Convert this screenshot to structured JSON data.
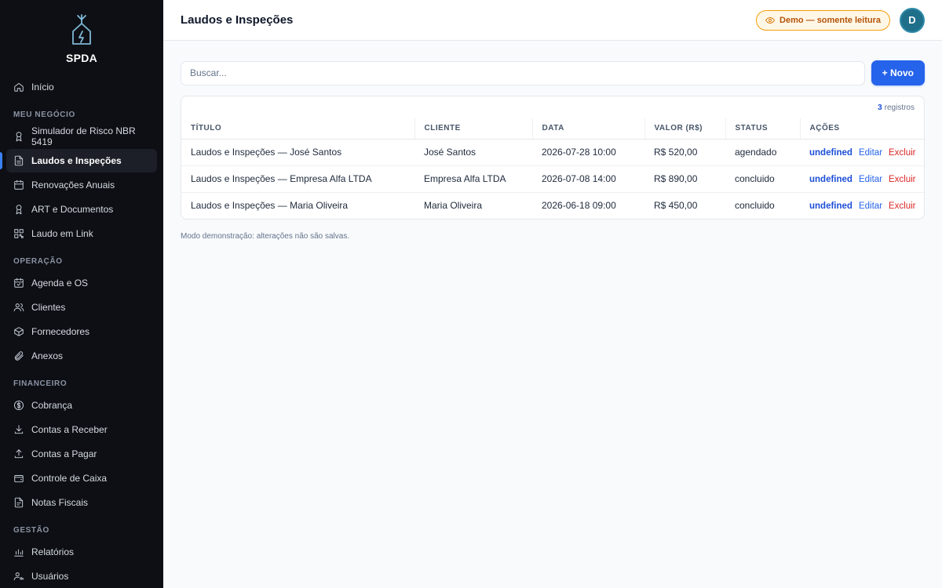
{
  "brand": {
    "name": "SPDA"
  },
  "sidebar": {
    "top": [
      {
        "label": "Início",
        "icon": "home-icon"
      }
    ],
    "sections": [
      {
        "title": "MEU NEGÓCIO",
        "items": [
          {
            "label": "Simulador de Risco NBR 5419",
            "icon": "award-icon"
          },
          {
            "label": "Laudos e Inspeções",
            "icon": "file-text-icon",
            "active": true
          },
          {
            "label": "Renovações Anuais",
            "icon": "calendar-icon"
          },
          {
            "label": "ART e Documentos",
            "icon": "award-icon"
          },
          {
            "label": "Laudo em Link",
            "icon": "qr-code-icon"
          }
        ]
      },
      {
        "title": "OPERAÇÃO",
        "items": [
          {
            "label": "Agenda e OS",
            "icon": "calendar-check-icon"
          },
          {
            "label": "Clientes",
            "icon": "users-icon"
          },
          {
            "label": "Fornecedores",
            "icon": "package-icon"
          },
          {
            "label": "Anexos",
            "icon": "paperclip-icon"
          }
        ]
      },
      {
        "title": "FINANCEIRO",
        "items": [
          {
            "label": "Cobrança",
            "icon": "dollar-circle-icon"
          },
          {
            "label": "Contas a Receber",
            "icon": "download-icon"
          },
          {
            "label": "Contas a Pagar",
            "icon": "upload-icon"
          },
          {
            "label": "Controle de Caixa",
            "icon": "wallet-icon"
          },
          {
            "label": "Notas Fiscais",
            "icon": "file-icon"
          }
        ]
      },
      {
        "title": "GESTÃO",
        "items": [
          {
            "label": "Relatórios",
            "icon": "bar-chart-icon"
          },
          {
            "label": "Usuários",
            "icon": "user-key-icon"
          }
        ]
      }
    ]
  },
  "header": {
    "title": "Laudos e Inspeções",
    "demo_badge": "Demo — somente leitura",
    "avatar_initial": "D"
  },
  "search": {
    "placeholder": "Buscar...",
    "value": ""
  },
  "new_button": "+ Novo",
  "records": {
    "count": "3",
    "label": "registros"
  },
  "table": {
    "columns": [
      "TÍTULO",
      "CLIENTE",
      "DATA",
      "VALOR (R$)",
      "STATUS",
      "AÇÕES"
    ],
    "rows": [
      {
        "titulo": "Laudos e Inspeções — José Santos",
        "cliente": "José Santos",
        "data": "2026-07-28 10:00",
        "valor": "R$ 520,00",
        "status": "agendado"
      },
      {
        "titulo": "Laudos e Inspeções — Empresa Alfa LTDA",
        "cliente": "Empresa Alfa LTDA",
        "data": "2026-07-08 14:00",
        "valor": "R$ 890,00",
        "status": "concluido"
      },
      {
        "titulo": "Laudos e Inspeções — Maria Oliveira",
        "cliente": "Maria Oliveira",
        "data": "2026-06-18 09:00",
        "valor": "R$ 450,00",
        "status": "concluido"
      }
    ],
    "actions": {
      "view": "undefined",
      "edit": "Editar",
      "delete": "Excluir"
    }
  },
  "footnote": "Modo demonstração: alterações não são salvas.",
  "colors": {
    "sidebar_bg": "#0d0f14",
    "accent": "#2563eb",
    "danger": "#dc2626",
    "badge": "#b45309"
  }
}
